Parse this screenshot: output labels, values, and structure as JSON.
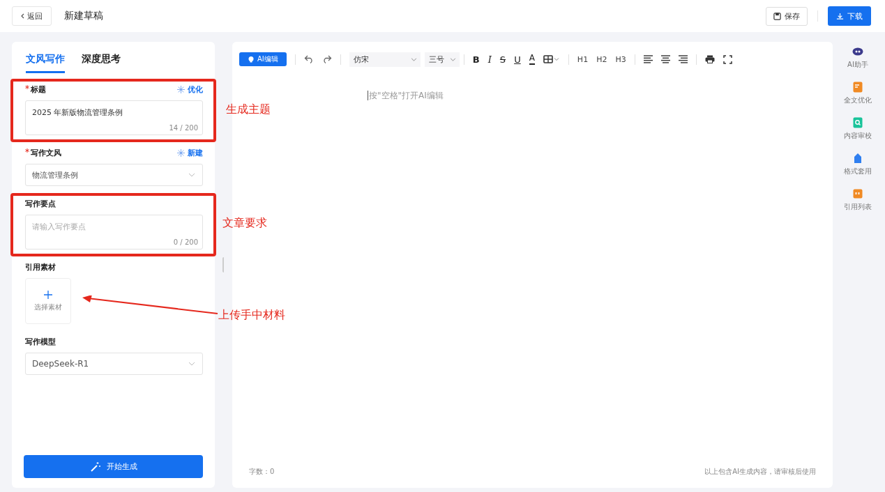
{
  "header": {
    "back": "返回",
    "title": "新建草稿",
    "save": "保存",
    "download": "下载"
  },
  "panel": {
    "tabs": [
      {
        "label": "文风写作",
        "selected": true
      },
      {
        "label": "深度思考",
        "selected": false
      }
    ],
    "title_field": {
      "label": "标题",
      "required": true,
      "action": "优化",
      "value": "2025 年新版物流管理条例",
      "counter": "14 / 200",
      "highlighted": true
    },
    "style_field": {
      "label": "写作文风",
      "required": true,
      "action": "新建",
      "value": "物流管理条例"
    },
    "points_field": {
      "label": "写作要点",
      "required": false,
      "placeholder": "请输入写作要点",
      "counter": "0 / 200",
      "highlighted": true
    },
    "material": {
      "label": "引用素材",
      "button": "选择素材"
    },
    "model": {
      "label": "写作模型",
      "value": "DeepSeek-R1"
    },
    "generate": "开始生成"
  },
  "annotations": [
    "生成主题",
    "文章要求",
    "上传手中材料"
  ],
  "toolbar": [
    {
      "kind": "ai",
      "label": "AI编辑"
    },
    {
      "kind": "sep"
    },
    {
      "kind": "undo"
    },
    {
      "kind": "redo"
    },
    {
      "kind": "sep"
    },
    {
      "kind": "select",
      "label": "仿宋",
      "wide": true
    },
    {
      "kind": "select",
      "label": "三号",
      "wide": false
    },
    {
      "kind": "sep"
    },
    {
      "kind": "bold",
      "label": "B"
    },
    {
      "kind": "italic",
      "label": "I"
    },
    {
      "kind": "strike",
      "label": "S"
    },
    {
      "kind": "underline",
      "label": "U"
    },
    {
      "kind": "color",
      "label": "A"
    },
    {
      "kind": "table"
    },
    {
      "kind": "sep"
    },
    {
      "kind": "heading",
      "label": "H1"
    },
    {
      "kind": "heading",
      "label": "H2"
    },
    {
      "kind": "heading",
      "label": "H3"
    },
    {
      "kind": "sep"
    },
    {
      "kind": "align_left"
    },
    {
      "kind": "align_center"
    },
    {
      "kind": "align_right"
    },
    {
      "kind": "sep"
    },
    {
      "kind": "print"
    },
    {
      "kind": "fullscreen"
    }
  ],
  "editor": {
    "placeholder": "按\"空格\"打开AI编辑",
    "word_count": "字数：0",
    "disclaimer": "以上包含AI生成内容，请审核后使用"
  },
  "sidebar": [
    {
      "label": "AI助手",
      "kind": "robot",
      "color": "#3b3a8c"
    },
    {
      "label": "全文优化",
      "kind": "doc",
      "color": "#f08a24"
    },
    {
      "label": "内容审校",
      "kind": "search",
      "color": "#19c39a"
    },
    {
      "label": "格式套用",
      "kind": "layers",
      "color": "#2f7ff0"
    },
    {
      "label": "引用列表",
      "kind": "quote",
      "color": "#f08a24"
    }
  ]
}
